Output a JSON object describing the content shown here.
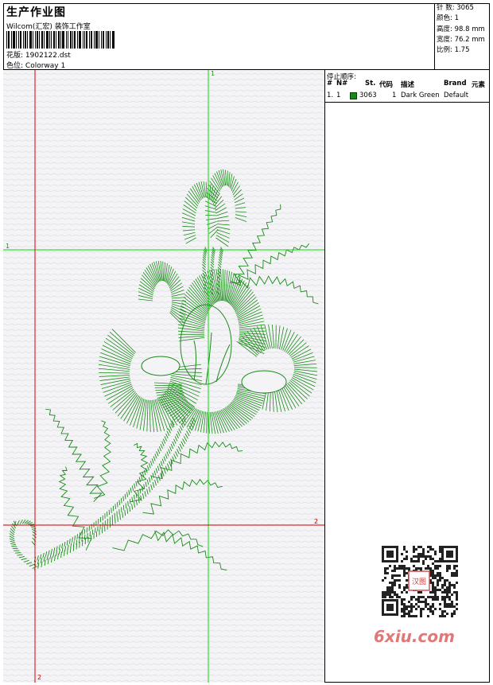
{
  "header": {
    "title": "生产作业图",
    "subtitle": "Wilcom(汇宏) 装饰工作室",
    "design_label": "花版:",
    "design_value": "1902122.dst",
    "colorway_label": "色位:",
    "colorway_value": "Colorway 1"
  },
  "stats": {
    "stitches": "针 数: 3065",
    "colors": "颜色: 1",
    "height": "高度: 98.8 mm",
    "width": "宽度: 76.2 mm",
    "ratio": "比例: 1.75"
  },
  "stop_sequence": {
    "title": "停止顺序:",
    "headers": {
      "index": "#",
      "number": "N#",
      "stitches": "St.",
      "code": "代码",
      "description": "描述",
      "brand": "Brand",
      "element": "元素"
    },
    "rows": [
      {
        "index": "1.",
        "number": "1",
        "swatch_color": "#1a8a1a",
        "stitches": "3063",
        "code": "1",
        "description": "Dark Green",
        "brand": "Default"
      }
    ]
  },
  "guides": {
    "top_label": "1",
    "left_label": "1",
    "right_label": "2",
    "bottom_label": "2"
  },
  "colors": {
    "thread": "#1a8a1a",
    "guide_green": "#00dd00",
    "guide_red": "#dd0000",
    "watermark": "#e07878"
  },
  "watermark": {
    "text": "6xiu.com",
    "stamp_text": "汉图"
  }
}
